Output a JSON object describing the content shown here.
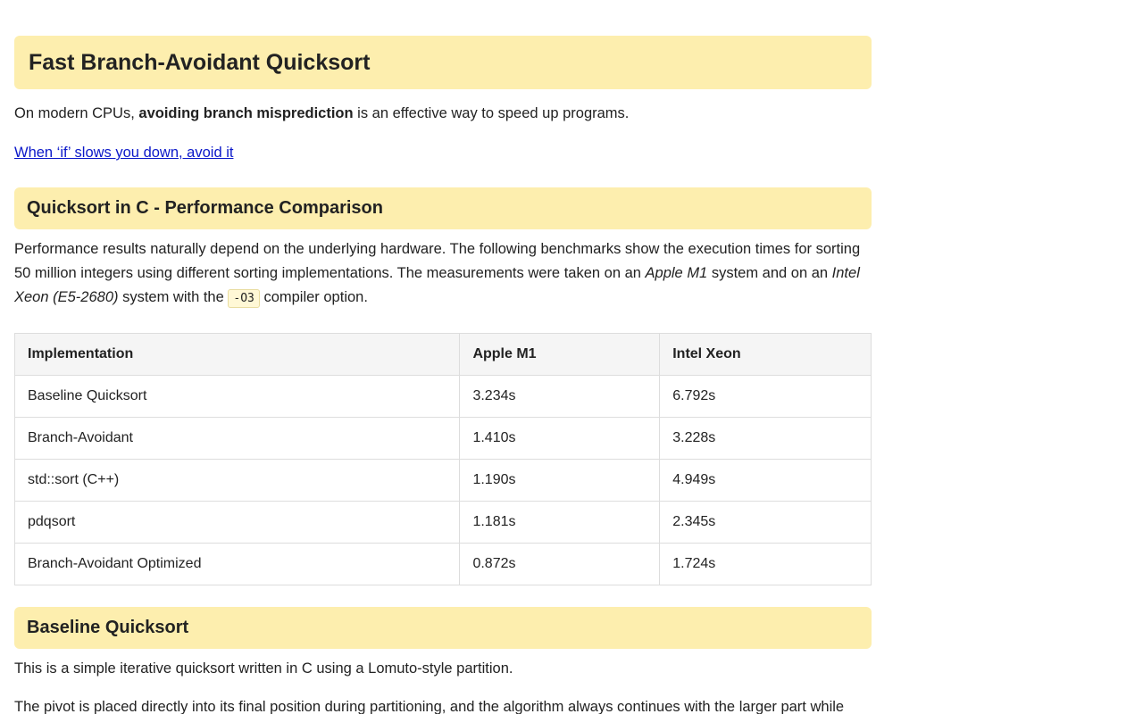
{
  "title": "Fast Branch-Avoidant Quicksort",
  "intro": {
    "before": "On modern CPUs, ",
    "bold": "avoiding branch misprediction",
    "after": " is an effective way to speed up programs."
  },
  "link_text": "When ‘if’ slows you down, avoid it",
  "section1": {
    "heading": "Quicksort in C - Performance Comparison",
    "para_part1": "Performance results naturally depend on the underlying hardware. The following benchmarks show the execution times for sorting 50 million integers using different sorting implementations. The measurements were taken on an ",
    "italic1": "Apple M1",
    "para_part2": " system and on an ",
    "italic2": "Intel Xeon (E5-2680)",
    "para_part3": " system with the ",
    "code": "-O3",
    "para_part4": " compiler option."
  },
  "table": {
    "headers": [
      "Implementation",
      "Apple M1",
      "Intel Xeon"
    ],
    "rows": [
      [
        "Baseline Quicksort",
        "3.234s",
        "6.792s"
      ],
      [
        "Branch-Avoidant",
        "1.410s",
        "3.228s"
      ],
      [
        "std::sort (C++)",
        "1.190s",
        "4.949s"
      ],
      [
        "pdqsort",
        "1.181s",
        "2.345s"
      ],
      [
        "Branch-Avoidant Optimized",
        "0.872s",
        "1.724s"
      ]
    ]
  },
  "section2": {
    "heading": "Baseline Quicksort",
    "para1": "This is a simple iterative quicksort written in C using a Lomuto-style partition.",
    "para2": "The pivot is placed directly into its final position during partitioning, and the algorithm always continues with the larger part while"
  }
}
